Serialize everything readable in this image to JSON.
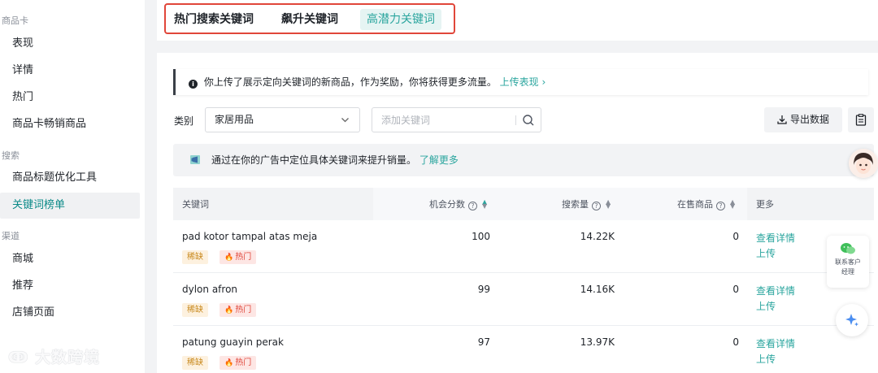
{
  "sidebar": {
    "groups": [
      {
        "title": "商品卡",
        "items": [
          {
            "label": "表现"
          },
          {
            "label": "详情"
          },
          {
            "label": "热门"
          },
          {
            "label": "商品卡畅销商品"
          }
        ]
      },
      {
        "title": "搜索",
        "items": [
          {
            "label": "商品标题优化工具"
          },
          {
            "label": "关键词榜单",
            "active": true
          }
        ]
      },
      {
        "title": "渠道",
        "items": [
          {
            "label": "商城"
          },
          {
            "label": "推荐"
          },
          {
            "label": "店铺页面"
          }
        ]
      }
    ]
  },
  "tabs": [
    {
      "label": "热门搜索关键词"
    },
    {
      "label": "飙升关键词"
    },
    {
      "label": "高潜力关键词",
      "active": true
    }
  ],
  "notice": {
    "text": "你上传了展示定向关键词的新商品，作为奖励，你将获得更多流量。",
    "link": "上传表现 ›"
  },
  "filters": {
    "category_label": "类别",
    "category_value": "家居用品",
    "search_placeholder": "添加关键词",
    "export_label": "导出数据"
  },
  "tip": {
    "text": "通过在你的广告中定位具体关键词来提升销量。",
    "link": "了解更多"
  },
  "table": {
    "headers": {
      "keyword": "关键词",
      "opportunity": "机会分数",
      "search_volume": "搜索量",
      "on_sale": "在售商品",
      "more": "更多"
    },
    "badge_labels": {
      "scarce": "稀缺",
      "hot": "热门"
    },
    "action_labels": {
      "details": "查看详情",
      "upload": "上传"
    },
    "rows": [
      {
        "keyword": "pad kotor tampal atas meja",
        "score": "100",
        "volume": "14.22K",
        "on_sale": "0"
      },
      {
        "keyword": "dylon afron",
        "score": "99",
        "volume": "14.16K",
        "on_sale": "0"
      },
      {
        "keyword": "patung guayin perak",
        "score": "97",
        "volume": "13.97K",
        "on_sale": "0"
      }
    ]
  },
  "widgets": {
    "contact_label": "联系客户经理"
  },
  "watermark": "大数跨境",
  "colors": {
    "accent": "#2aa59e",
    "tab_highlight_border": "#e0463a",
    "hot": "#e0463a",
    "scarce": "#c98a1f"
  }
}
